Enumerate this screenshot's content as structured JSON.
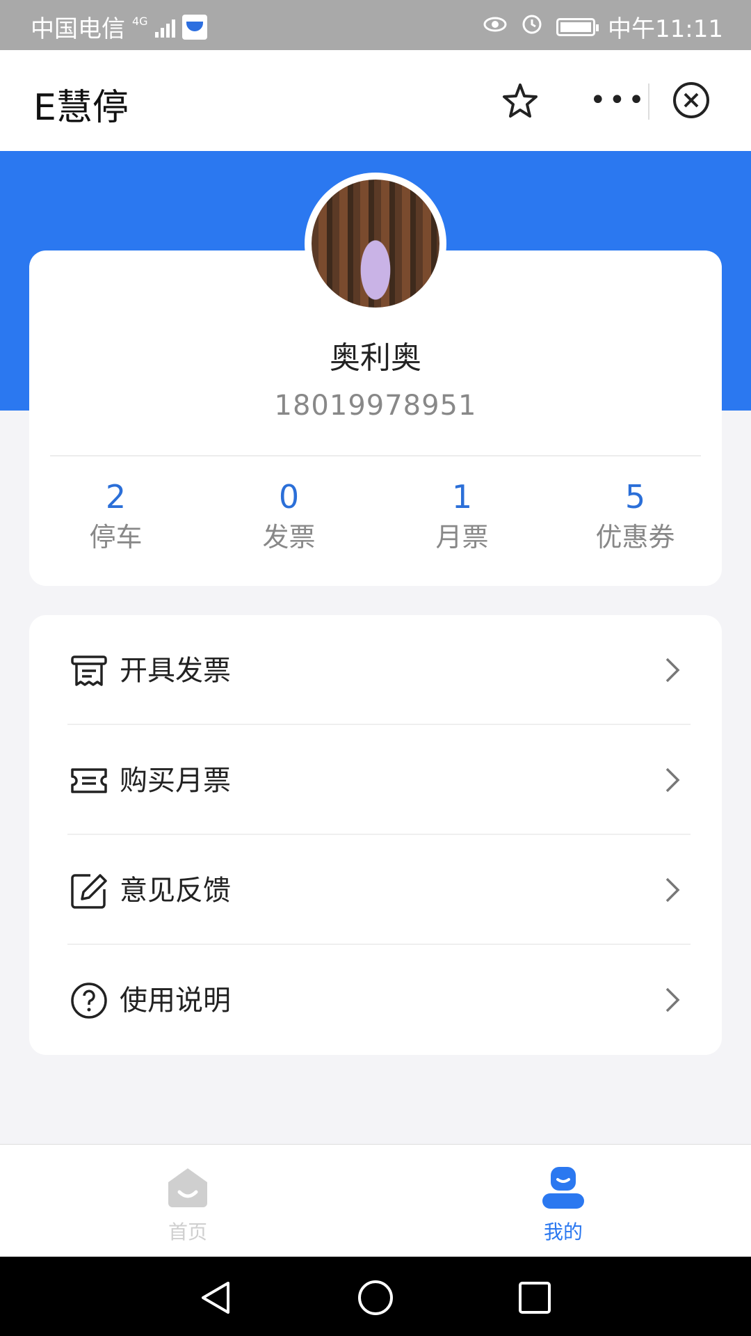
{
  "status_bar": {
    "carrier": "中国电信",
    "network": "4G",
    "time": "中午11:11"
  },
  "nav": {
    "title": "E慧停",
    "more": "•••"
  },
  "profile": {
    "name": "奥利奥",
    "phone": "18019978951",
    "stats": [
      {
        "value": "2",
        "label": "停车"
      },
      {
        "value": "0",
        "label": "发票"
      },
      {
        "value": "1",
        "label": "月票"
      },
      {
        "value": "5",
        "label": "优惠券"
      }
    ]
  },
  "menu": [
    {
      "label": "开具发票",
      "icon": "invoice-icon"
    },
    {
      "label": "购买月票",
      "icon": "ticket-icon"
    },
    {
      "label": "意见反馈",
      "icon": "edit-icon"
    },
    {
      "label": "使用说明",
      "icon": "help-icon"
    }
  ],
  "tabs": [
    {
      "label": "首页",
      "icon": "home-icon",
      "active": false
    },
    {
      "label": "我的",
      "icon": "user-icon",
      "active": true
    }
  ],
  "colors": {
    "accent": "#2b78f0",
    "stat_number": "#2b6fd8",
    "tab_inactive": "#cfcfcf"
  }
}
